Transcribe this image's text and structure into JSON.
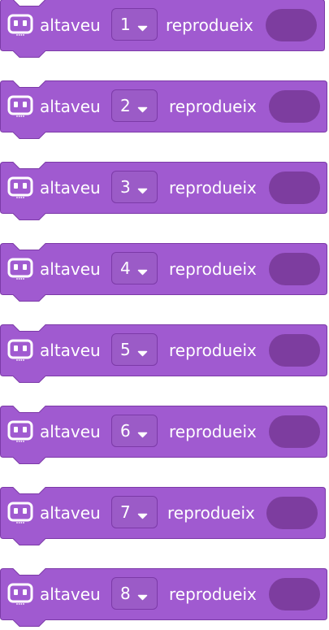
{
  "colors": {
    "block_fill": "#a05ad0",
    "block_stroke": "#7c3aa8",
    "dropdown_fill": "#9b5bc7",
    "slot_fill": "#7d3d9f",
    "text": "#ffffff"
  },
  "icon": "speaker-box-icon",
  "blocks": [
    {
      "prefix": "altaveu",
      "value": "1",
      "suffix": "reprodueix"
    },
    {
      "prefix": "altaveu",
      "value": "2",
      "suffix": "reprodueix"
    },
    {
      "prefix": "altaveu",
      "value": "3",
      "suffix": "reprodueix"
    },
    {
      "prefix": "altaveu",
      "value": "4",
      "suffix": "reprodueix"
    },
    {
      "prefix": "altaveu",
      "value": "5",
      "suffix": "reprodueix"
    },
    {
      "prefix": "altaveu",
      "value": "6",
      "suffix": "reprodueix"
    },
    {
      "prefix": "altaveu",
      "value": "7",
      "suffix": "reprodueix"
    },
    {
      "prefix": "altaveu",
      "value": "8",
      "suffix": "reprodueix"
    }
  ]
}
